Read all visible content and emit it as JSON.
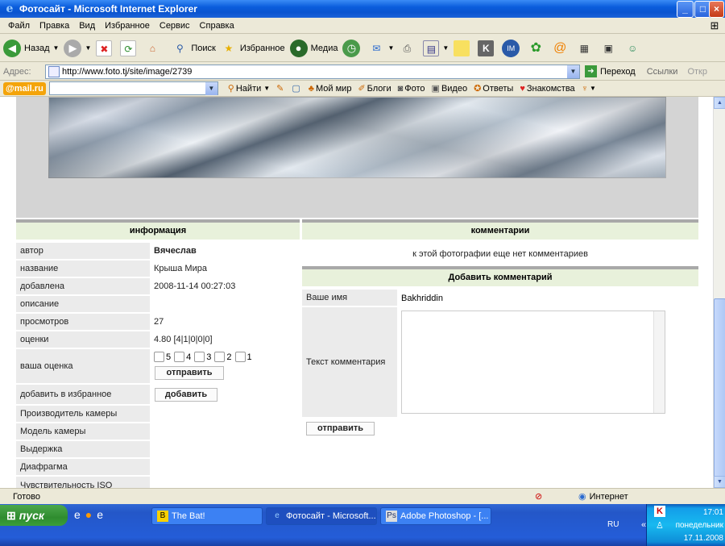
{
  "window": {
    "title": "Фотосайт - Microsoft Internet Explorer",
    "minimize": "_",
    "maximize": "□",
    "close": "×"
  },
  "menu": [
    "Файл",
    "Правка",
    "Вид",
    "Избранное",
    "Сервис",
    "Справка"
  ],
  "toolbar": {
    "back": "Назад",
    "search": "Поиск",
    "favorites": "Избранное",
    "media": "Медиа"
  },
  "address": {
    "label": "Адрес:",
    "url": "http://www.foto.tj/site/image/2739",
    "go": "Переход",
    "links": "Ссылки",
    "open": "Откр"
  },
  "mailbar": {
    "logo": "@mail.ru",
    "find": "Найти",
    "moi_mir": "Мой мир",
    "blogs": "Блоги",
    "photo": "Фото",
    "video": "Видео",
    "answers": "Ответы",
    "dating": "Знакомства"
  },
  "info": {
    "header": "информация",
    "rows": [
      {
        "label": "автор",
        "value": "Вячеслав"
      },
      {
        "label": "название",
        "value": "Крыша Мира"
      },
      {
        "label": "добавлена",
        "value": "2008-11-14 00:27:03"
      },
      {
        "label": "описание",
        "value": ""
      },
      {
        "label": "просмотров",
        "value": "27"
      },
      {
        "label": "оценки",
        "value": "4.80 [4|1|0|0|0]"
      },
      {
        "label": "ваша оценка",
        "value": ""
      },
      {
        "label": "добавить в избранное",
        "value": ""
      },
      {
        "label": "Производитель камеры",
        "value": ""
      },
      {
        "label": "Модель камеры",
        "value": ""
      },
      {
        "label": "Выдержка",
        "value": ""
      },
      {
        "label": "Диафрагма",
        "value": ""
      },
      {
        "label": "Чувствительность ISO",
        "value": ""
      }
    ],
    "rating_options": [
      "5",
      "4",
      "3",
      "2",
      "1"
    ],
    "rate_button": "отправить",
    "fav_button": "добавить"
  },
  "comments": {
    "header": "комментарии",
    "empty": "к этой фотографии еще нет комментариев",
    "add_header": "Добавить комментарий",
    "name_label": "Ваше имя",
    "name_value": "Bakhriddin",
    "text_label": "Текст комментария",
    "submit": "отправить"
  },
  "status": {
    "text": "Готово",
    "zone": "Интернет"
  },
  "taskbar": {
    "start": "пуск",
    "tasks": [
      "The Bat!",
      "Фотосайт - Microsoft...",
      "Adobe Photoshop - [..."
    ],
    "lang": "RU",
    "time": "17:01",
    "day": "понедельник",
    "date": "17.11.2008"
  },
  "colors": {
    "header_bg": "#e8f1db",
    "label_bg": "#ebebeb",
    "xp_blue": "#245dd8"
  }
}
